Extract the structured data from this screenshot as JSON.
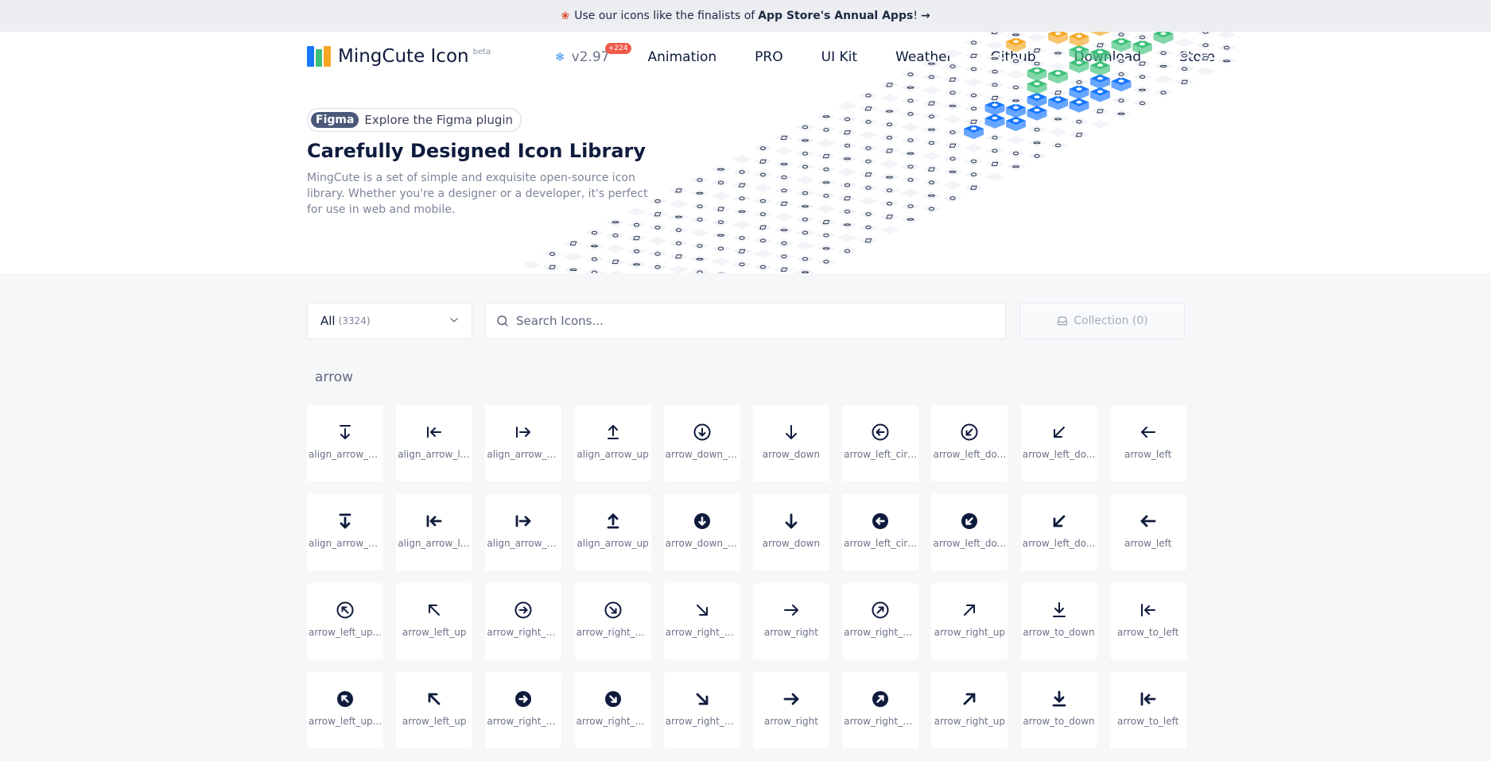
{
  "banner": {
    "emoji": "❀",
    "prefix": "Use our icons like the finalists of",
    "highlight": "App Store's Annual Apps",
    "suffix": "!",
    "arrow": "→"
  },
  "logo": {
    "name": "MingCute Icon",
    "badge": "beta"
  },
  "nav": {
    "version": "v2.97",
    "version_badge": "+224",
    "items": [
      "Animation",
      "PRO",
      "UI Kit",
      "Weather",
      "Github",
      "Download",
      "Store"
    ]
  },
  "hero": {
    "figma_tag": "Figma",
    "figma_text": "Explore the Figma plugin",
    "title": "Carefully Designed Icon Library",
    "description": "MingCute is a set of simple and exquisite open-source icon library. Whether you're a designer or a developer, it's perfect for use in web and mobile."
  },
  "toolbar": {
    "category": "All",
    "category_count": "(3324)",
    "search_placeholder": "Search Icons...",
    "collection": "Collection (0)"
  },
  "section": {
    "label": "arrow"
  },
  "colors": {
    "accent_blue": "#1677ff",
    "accent_green": "#3cc17a",
    "accent_orange": "#f5a623",
    "text_dark": "#0f1b3d"
  },
  "icons": [
    {
      "label": "align_arrow_d...",
      "icon": "align-arrow-down",
      "filled": false
    },
    {
      "label": "align_arrow_left",
      "icon": "align-arrow-left",
      "filled": false
    },
    {
      "label": "align_arrow_ri...",
      "icon": "align-arrow-right",
      "filled": false
    },
    {
      "label": "align_arrow_up",
      "icon": "align-arrow-up",
      "filled": false
    },
    {
      "label": "arrow_down_c...",
      "icon": "arrow-down-circle",
      "filled": false
    },
    {
      "label": "arrow_down",
      "icon": "arrow-down",
      "filled": false
    },
    {
      "label": "arrow_left_circle",
      "icon": "arrow-left-circle",
      "filled": false
    },
    {
      "label": "arrow_left_do...",
      "icon": "arrow-left-down-circle",
      "filled": false
    },
    {
      "label": "arrow_left_do...",
      "icon": "arrow-left-down",
      "filled": false
    },
    {
      "label": "arrow_left",
      "icon": "arrow-left",
      "filled": false
    },
    {
      "label": "align_arrow_d...",
      "icon": "align-arrow-down",
      "filled": true
    },
    {
      "label": "align_arrow_left",
      "icon": "align-arrow-left",
      "filled": true
    },
    {
      "label": "align_arrow_ri...",
      "icon": "align-arrow-right",
      "filled": true
    },
    {
      "label": "align_arrow_up",
      "icon": "align-arrow-up",
      "filled": true
    },
    {
      "label": "arrow_down_c...",
      "icon": "arrow-down-circle",
      "filled": true
    },
    {
      "label": "arrow_down",
      "icon": "arrow-down",
      "filled": true
    },
    {
      "label": "arrow_left_circle",
      "icon": "arrow-left-circle",
      "filled": true
    },
    {
      "label": "arrow_left_do...",
      "icon": "arrow-left-down-circle",
      "filled": true
    },
    {
      "label": "arrow_left_do...",
      "icon": "arrow-left-down",
      "filled": true
    },
    {
      "label": "arrow_left",
      "icon": "arrow-left",
      "filled": true
    },
    {
      "label": "arrow_left_up...",
      "icon": "arrow-left-up-circle",
      "filled": false
    },
    {
      "label": "arrow_left_up",
      "icon": "arrow-left-up",
      "filled": false
    },
    {
      "label": "arrow_right_ci...",
      "icon": "arrow-right-circle",
      "filled": false
    },
    {
      "label": "arrow_right_d...",
      "icon": "arrow-right-down-circle",
      "filled": false
    },
    {
      "label": "arrow_right_d...",
      "icon": "arrow-right-down",
      "filled": false
    },
    {
      "label": "arrow_right",
      "icon": "arrow-right",
      "filled": false
    },
    {
      "label": "arrow_right_u...",
      "icon": "arrow-right-up-circle",
      "filled": false
    },
    {
      "label": "arrow_right_up",
      "icon": "arrow-right-up",
      "filled": false
    },
    {
      "label": "arrow_to_down",
      "icon": "arrow-to-down",
      "filled": false
    },
    {
      "label": "arrow_to_left",
      "icon": "arrow-to-left",
      "filled": false
    },
    {
      "label": "arrow_left_up...",
      "icon": "arrow-left-up-circle",
      "filled": true
    },
    {
      "label": "arrow_left_up",
      "icon": "arrow-left-up",
      "filled": true
    },
    {
      "label": "arrow_right_ci...",
      "icon": "arrow-right-circle",
      "filled": true
    },
    {
      "label": "arrow_right_d...",
      "icon": "arrow-right-down-circle",
      "filled": true
    },
    {
      "label": "arrow_right_d...",
      "icon": "arrow-right-down",
      "filled": true
    },
    {
      "label": "arrow_right",
      "icon": "arrow-right",
      "filled": true
    },
    {
      "label": "arrow_right_u...",
      "icon": "arrow-right-up-circle",
      "filled": true
    },
    {
      "label": "arrow_right_up",
      "icon": "arrow-right-up",
      "filled": true
    },
    {
      "label": "arrow_to_down",
      "icon": "arrow-to-down",
      "filled": true
    },
    {
      "label": "arrow_to_left",
      "icon": "arrow-to-left",
      "filled": true
    }
  ]
}
